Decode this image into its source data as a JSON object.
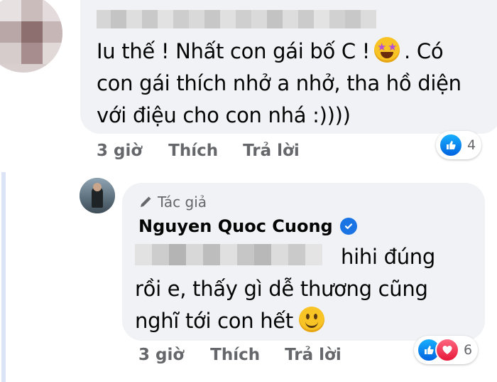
{
  "comment1": {
    "text_line1_a": "Iu thế ! Nhất con gái bố C !",
    "text_line1_b": ". Có",
    "text_line2": "con gái thích nhở a nhở, tha hồ diện",
    "text_line3": "với điệu cho con nhá :))))",
    "emoji": "star-struck-emoji",
    "time": "3 giờ",
    "like_label": "Thích",
    "reply_label": "Trả lời",
    "reaction_count": "4",
    "reactions": [
      "like"
    ]
  },
  "reply": {
    "author_badge_label": "Tác giả",
    "author_name": "Nguyen Quoc Cuong",
    "verified": true,
    "text_line1": "hihi đúng",
    "text_line2": "rồi e, thấy gì dễ thương cũng",
    "text_line3": "nghĩ tới con hết",
    "emoji": "smiling-face-emoji",
    "time": "3 giờ",
    "like_label": "Thích",
    "reply_label": "Trả lời",
    "reaction_count": "6",
    "reactions": [
      "like",
      "love"
    ]
  },
  "colors": {
    "bubble": "#f0f2f5",
    "secondary_text": "#65676b",
    "verified_blue": "#1b74e4",
    "like_blue": "#0062df",
    "love_red": "#e61739"
  }
}
